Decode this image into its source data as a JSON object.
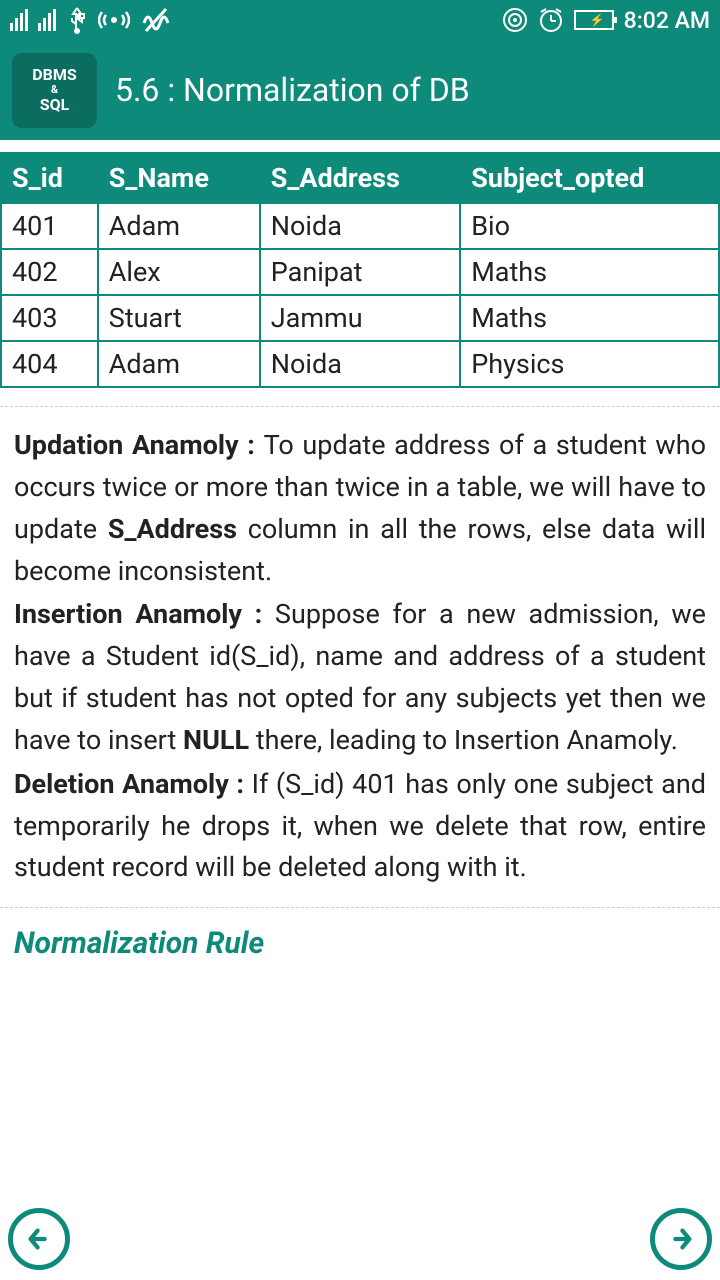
{
  "status": {
    "time": "8:02 AM"
  },
  "app_icon": {
    "line1": "DBMS",
    "line2": "&",
    "line3": "SQL"
  },
  "page_title": "5.6 : Normalization of DB",
  "table": {
    "headers": [
      "S_id",
      "S_Name",
      "S_Address",
      "Subject_opted"
    ],
    "rows": [
      [
        "401",
        "Adam",
        "Noida",
        "Bio"
      ],
      [
        "402",
        "Alex",
        "Panipat",
        "Maths"
      ],
      [
        "403",
        "Stuart",
        "Jammu",
        "Maths"
      ],
      [
        "404",
        "Adam",
        "Noida",
        "Physics"
      ]
    ]
  },
  "paragraphs": {
    "updation": {
      "label": "Updation Anamoly : ",
      "text1": "To update address of a student who occurs twice or more than twice in a table, we will have to update ",
      "bold1": "S_Address",
      "text2": " column in all the rows, else data will become inconsistent."
    },
    "insertion": {
      "label": "Insertion Anamoly : ",
      "text1": "Suppose for a new admission, we have a Student id(S_id), name and address of a student but if student has not opted for any subjects yet then we have to insert ",
      "bold1": "NULL",
      "text2": " there, leading to Insertion Anamoly."
    },
    "deletion": {
      "label": "Deletion Anamoly : ",
      "text1": "If (S_id) 401 has only one subject and temporarily he drops it, when we delete that row, entire student record will be deleted along with it."
    }
  },
  "section_title": "Normalization Rule"
}
